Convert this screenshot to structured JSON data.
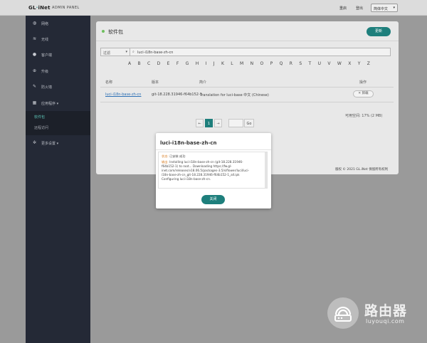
{
  "header": {
    "brand_a": "GL",
    "brand_dot": "·",
    "brand_b": "iNet",
    "subtitle": "ADMIN PANEL",
    "link_upgrade": "重启",
    "link_logout": "登出",
    "language": "简体中文"
  },
  "sidebar": {
    "items": [
      {
        "label": "网络",
        "icon": "globe-icon"
      },
      {
        "label": "无线",
        "icon": "wifi-icon"
      },
      {
        "label": "客户端",
        "icon": "user-icon"
      },
      {
        "label": "升级",
        "icon": "upgrade-icon"
      },
      {
        "label": "防火墙",
        "icon": "firewall-icon"
      },
      {
        "label": "应用程序",
        "icon": "apps-icon"
      },
      {
        "label": "更多设置",
        "icon": "gear-icon"
      }
    ],
    "sub_items": [
      "软件包",
      "远程访问"
    ]
  },
  "panel": {
    "title": "软件包",
    "refresh_label": "更新",
    "filter_label": "过滤",
    "search_value": "luci-i18n-base-zh-cn",
    "alphabet": [
      "A",
      "B",
      "C",
      "D",
      "E",
      "F",
      "G",
      "H",
      "I",
      "J",
      "K",
      "L",
      "M",
      "N",
      "O",
      "P",
      "Q",
      "R",
      "S",
      "T",
      "U",
      "V",
      "W",
      "X",
      "Y",
      "Z"
    ],
    "columns": {
      "name": "名称",
      "version": "版本",
      "desc": "简介",
      "action": "操作"
    },
    "rows": [
      {
        "name": "luci-i18n-base-zh-cn",
        "version": "git-18.228.31946-f64b152-1",
        "desc": "Translation for luci-base 中文 (Chinese)",
        "action": "卸载"
      }
    ],
    "available": "可用空间: 17% (2 MB)",
    "pager": {
      "prev": "←",
      "current": "1",
      "next": "→",
      "go": "Go"
    },
    "footer": "版权 © 2021 GL.iNet 保留所有权利"
  },
  "modal": {
    "title": "luci-i18n-base-zh-cn",
    "status_key": "状态:",
    "status_val": "已安装 成功",
    "output_key": "输出:",
    "output_lines": [
      "Installing luci-i18n-base-zh-cn (git-18.228.31946-",
      "f64b152-1) to root... Downloading https://fw.gl-",
      "inet.com/releases/v18.06.5/packages-3.5/siflower/luci/luci-",
      "i18n-base-zh-cn_git-18.228.31946-f64b152-1_all.ipk",
      "Configuring luci-i18n-base-zh-cn."
    ],
    "close_label": "关闭"
  },
  "watermark": {
    "title": "路由器",
    "url": "luyouqi.com"
  }
}
